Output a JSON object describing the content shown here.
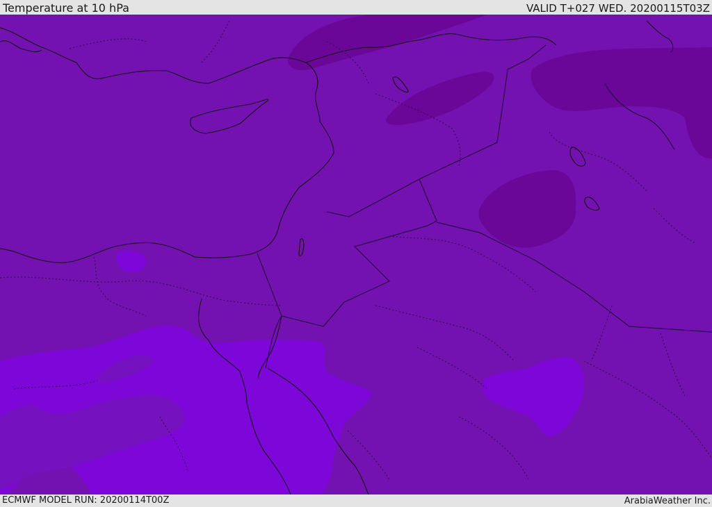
{
  "header": {
    "title": "Temperature at 10 hPa",
    "valid_time": "VALID T+027 WED. 20200115T03Z"
  },
  "footer": {
    "model_run": "ECMWF MODEL RUN: 20200114T00Z",
    "credit": "ArabiaWeather Inc."
  },
  "map": {
    "parameter": "temperature",
    "level": "10 hPa",
    "colors": {
      "base": "#7412b1",
      "cold": "#6a0798",
      "warm": "#7d06d8",
      "mid": "#7810c4",
      "coast": "#111111",
      "border": "#222222"
    }
  }
}
